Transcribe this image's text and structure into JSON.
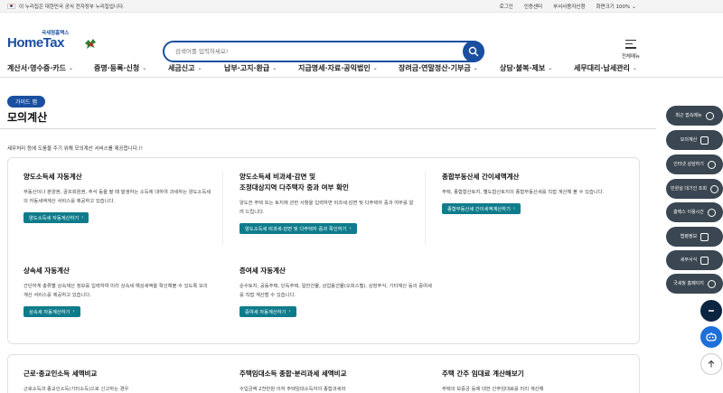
{
  "topbar": {
    "notice": "이 누리집은 대한민국 공식 전자정부 누리집입니다.",
    "links": [
      "로그인",
      "인증센터",
      "부서사용자신청",
      "화면크기 100%"
    ]
  },
  "header": {
    "logo_sub": "국세청홈택스",
    "logo_main": "HomeTax",
    "search_placeholder": "검색어를 입력하세요!",
    "all_menu_label": "전체메뉴"
  },
  "nav": {
    "items": [
      "계산서·영수증·카드",
      "증명·등록·신청",
      "세금신고",
      "납부·고지·환급",
      "지급명세·자료·공익법인",
      "장려금·연말정산·기부금",
      "상담·불복·제보",
      "세무대리·납세관리"
    ]
  },
  "page": {
    "guide_badge": "가이드 맵",
    "title": "모의계산",
    "intro": "세무처리 등에 도움을 주기 위해 모의계산 서비스를 제공합니다.!!"
  },
  "cards": [
    {
      "title": "양도소득세 자동계산",
      "desc": "부동산이나 분양권, 골프회원권, 주식 등을 팔 때 발생하는 소득에 대하여 과세하는 양도소득세의 자동세액계산 서비스를 제공하고 있습니다.",
      "button": "양도소득세 자동계산하기"
    },
    {
      "title_line1": "양도소득세 비과세·감면 및",
      "title_line2": "조정대상지역 다주택자 중과 여부 확인",
      "desc": "양도한 주택 또는 토지에 관한 사항을 입력하면 비과세·감면 및 다주택자 중과 여부를 알려 드립니다.",
      "button": "양도소득세 비과세·감면 및 다주택자 중과 확인하기"
    },
    {
      "title": "종합부동산세 간이세액계산",
      "desc": "주택, 종합합산토지, 별도합산토지의 종합부동산세를 직접 계산해 볼 수 있습니다.",
      "button": "종합부동산세 간이세액계산하기"
    },
    {
      "title": "상속세 자동계산",
      "desc": "간단하게 총류별 상속재산 정보를 입력하여 미리 상속세 예상세액을 확인해볼 수 있도록 모의계산 서비스를 제공하고 있습니다.",
      "button": "상속세 자동계산하기"
    },
    {
      "title": "증여세 자동계산",
      "desc": "순수토지, 공동주택, 단독주택, 일반건물, 상업용건물(오피스텔), 상장주식, 기타재산 등의 증여세를 직접 계산할 수 있습니다.",
      "button": "증여세 자동계산하기"
    },
    {
      "title": "근로·종교인소득 세액비교",
      "desc": "근로소득과 종교인소득(기타소득)으로 신고하는 경우"
    },
    {
      "title": "주택임대소득 종합·분리과세 세액비교",
      "desc": "수입금액 2천만원 이하 주택임대소득자의 종합과세와"
    },
    {
      "title": "주택 간주 임대료 계산해보기",
      "desc": "주택의 보증금 등에 대한 간주임대료를 미리 계산해"
    }
  ],
  "quick_menu": [
    "최근 접속메뉴",
    "모의계산",
    "인터넷 상담하기",
    "민원실 대기인 조회",
    "홈택스 이용시간",
    "법령정보",
    "세무서식",
    "국세청 홈페이지"
  ],
  "colors": {
    "brand_blue": "#1a4fa0",
    "teal_button": "#0f7c8c",
    "quick_menu_bg": "#3a4651"
  }
}
